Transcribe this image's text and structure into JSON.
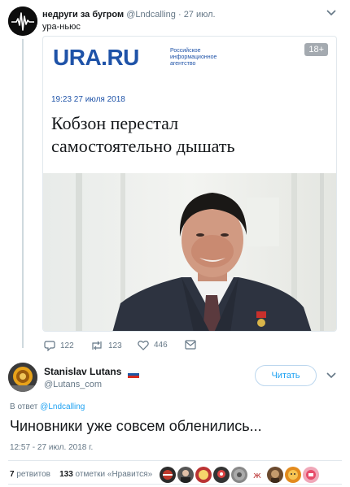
{
  "quoted": {
    "author_name": "недруги за бугром",
    "author_handle": "@Lndcalling",
    "separator": " · ",
    "time": "27 июл.",
    "text": "ура-ньюс",
    "card": {
      "logo": "URA.RU",
      "logo_sub_1": "Российское",
      "logo_sub_2": "информационное",
      "logo_sub_3": "агентство",
      "age_badge": "18+",
      "date": "19:23   27 июля 2018",
      "headline_1": "Кобзон перестал",
      "headline_2": "самостоятельно дышать"
    },
    "actions": {
      "replies": "122",
      "retweets": "123",
      "likes": "446"
    }
  },
  "main": {
    "author_name": "Stanislav Lutans",
    "author_handle": "@Lutans_com",
    "follow_label": "Читать",
    "reply_prefix": "В ответ ",
    "reply_to": "@Lndcalling",
    "text": "Чиновники уже совсем обленились...",
    "timestamp": "12:57 - 27 июл. 2018 г.",
    "retweet_count": "7",
    "retweet_label": " ретвитов",
    "like_count": "133",
    "like_label": " отметки «Нравится»"
  },
  "colors": {
    "accent": "#1da1f2",
    "brand": "#1f53a8",
    "muted": "#657786"
  },
  "icons": [
    "waveform-avatar-icon",
    "chevron-down-icon",
    "reply-icon",
    "retweet-icon",
    "heart-icon",
    "envelope-icon",
    "russian-flag-icon"
  ]
}
